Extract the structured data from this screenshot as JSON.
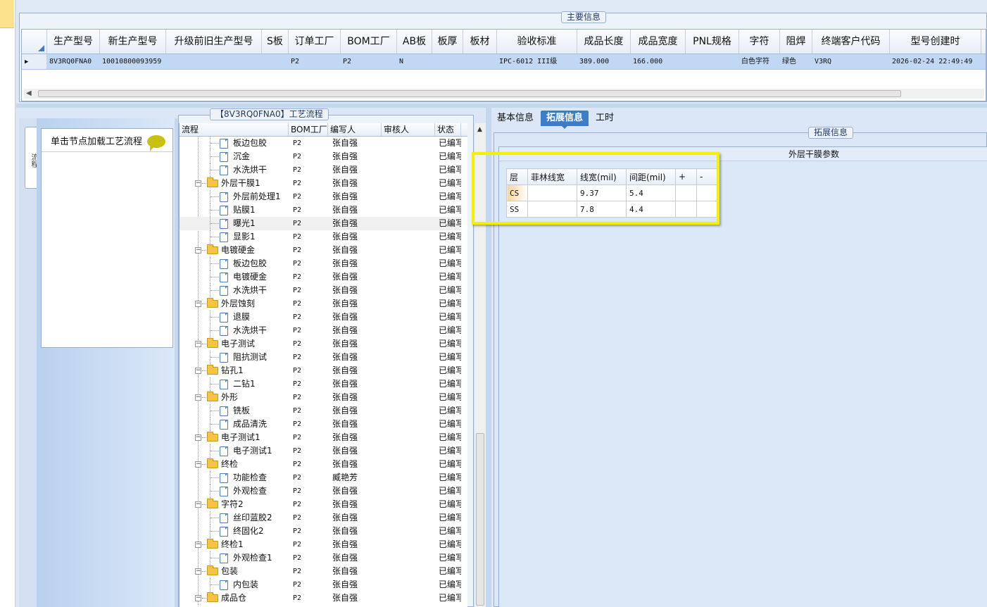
{
  "primary": {
    "title": "主要信息",
    "columns": [
      "生产型号",
      "新生产型号",
      "升级前旧生产型号",
      "S板",
      "订单工厂",
      "BOM工厂",
      "AB板",
      "板厚",
      "板材",
      "验收标准",
      "成品长度",
      "成品宽度",
      "PNL规格",
      "字符",
      "阻焊",
      "终端客户代码",
      "型号创建时"
    ],
    "row": [
      "8V3RQ0FNA0",
      "10010800093959",
      "",
      "",
      "P2",
      "P2",
      "N",
      "",
      "",
      "IPC-6012 III级",
      "389.000",
      "166.000",
      "",
      "白色字符",
      "绿色",
      "V3RQ",
      "2026-02-24 22:49:49"
    ],
    "row_marker": "▶"
  },
  "side_tab": "流程",
  "nav": {
    "hint": "单击节点加载工艺流程"
  },
  "process": {
    "title": "【8V3RQ0FNA0】工艺流程",
    "columns": [
      "流程",
      "BOM工厂",
      "编写人",
      "审核人",
      "状态"
    ],
    "rows": [
      {
        "name": "板边包胶",
        "level": 2,
        "bom": "P2",
        "writer": "张自强",
        "reviewer": "",
        "status": "已编写"
      },
      {
        "name": "沉金",
        "level": 2,
        "bom": "P2",
        "writer": "张自强",
        "reviewer": "",
        "status": "已编写"
      },
      {
        "name": "水洗烘干",
        "level": 2,
        "bom": "P2",
        "writer": "张自强",
        "reviewer": "",
        "status": "已编写"
      },
      {
        "name": "外层干膜1",
        "level": 1,
        "bom": "P2",
        "writer": "张自强",
        "reviewer": "",
        "status": "已编写"
      },
      {
        "name": "外层前处理1",
        "level": 2,
        "bom": "P2",
        "writer": "张自强",
        "reviewer": "",
        "status": "已编写"
      },
      {
        "name": "贴膜1",
        "level": 2,
        "bom": "P2",
        "writer": "张自强",
        "reviewer": "",
        "status": "已编写"
      },
      {
        "name": "曝光1",
        "level": 2,
        "bom": "P2",
        "writer": "张自强",
        "reviewer": "",
        "status": "已编写",
        "selected": true
      },
      {
        "name": "显影1",
        "level": 2,
        "bom": "P2",
        "writer": "张自强",
        "reviewer": "",
        "status": "已编写"
      },
      {
        "name": "电镀硬金",
        "level": 1,
        "bom": "P2",
        "writer": "张自强",
        "reviewer": "",
        "status": "已编写"
      },
      {
        "name": "板边包胶",
        "level": 2,
        "bom": "P2",
        "writer": "张自强",
        "reviewer": "",
        "status": "已编写"
      },
      {
        "name": "电镀硬金",
        "level": 2,
        "bom": "P2",
        "writer": "张自强",
        "reviewer": "",
        "status": "已编写"
      },
      {
        "name": "水洗烘干",
        "level": 2,
        "bom": "P2",
        "writer": "张自强",
        "reviewer": "",
        "status": "已编写"
      },
      {
        "name": "外层蚀刻",
        "level": 1,
        "bom": "P2",
        "writer": "张自强",
        "reviewer": "",
        "status": "已编写"
      },
      {
        "name": "退膜",
        "level": 2,
        "bom": "P2",
        "writer": "张自强",
        "reviewer": "",
        "status": "已编写"
      },
      {
        "name": "水洗烘干",
        "level": 2,
        "bom": "P2",
        "writer": "张自强",
        "reviewer": "",
        "status": "已编写"
      },
      {
        "name": "电子测试",
        "level": 1,
        "bom": "P2",
        "writer": "张自强",
        "reviewer": "",
        "status": "已编写"
      },
      {
        "name": "阻抗测试",
        "level": 2,
        "bom": "P2",
        "writer": "张自强",
        "reviewer": "",
        "status": "已编写"
      },
      {
        "name": "钻孔1",
        "level": 1,
        "bom": "P2",
        "writer": "张自强",
        "reviewer": "",
        "status": "已编写"
      },
      {
        "name": "二钻1",
        "level": 2,
        "bom": "P2",
        "writer": "张自强",
        "reviewer": "",
        "status": "已编写"
      },
      {
        "name": "外形",
        "level": 1,
        "bom": "P2",
        "writer": "张自强",
        "reviewer": "",
        "status": "已编写"
      },
      {
        "name": "铣板",
        "level": 2,
        "bom": "P2",
        "writer": "张自强",
        "reviewer": "",
        "status": "已编写"
      },
      {
        "name": "成品清洗",
        "level": 2,
        "bom": "P2",
        "writer": "张自强",
        "reviewer": "",
        "status": "已编写"
      },
      {
        "name": "电子测试1",
        "level": 1,
        "bom": "P2",
        "writer": "张自强",
        "reviewer": "",
        "status": "已编写"
      },
      {
        "name": "电子测试1",
        "level": 2,
        "bom": "P2",
        "writer": "张自强",
        "reviewer": "",
        "status": "已编写"
      },
      {
        "name": "终检",
        "level": 1,
        "bom": "P2",
        "writer": "张自强",
        "reviewer": "",
        "status": "已编写"
      },
      {
        "name": "功能检查",
        "level": 2,
        "bom": "P2",
        "writer": "臧艳芳",
        "reviewer": "",
        "status": "已编写"
      },
      {
        "name": "外观检查",
        "level": 2,
        "bom": "P2",
        "writer": "张自强",
        "reviewer": "",
        "status": "已编写"
      },
      {
        "name": "字符2",
        "level": 1,
        "bom": "P2",
        "writer": "张自强",
        "reviewer": "",
        "status": "已编写"
      },
      {
        "name": "丝印蓝胶2",
        "level": 2,
        "bom": "P2",
        "writer": "张自强",
        "reviewer": "",
        "status": "已编写"
      },
      {
        "name": "终固化2",
        "level": 2,
        "bom": "P2",
        "writer": "张自强",
        "reviewer": "",
        "status": "已编写"
      },
      {
        "name": "终检1",
        "level": 1,
        "bom": "P2",
        "writer": "张自强",
        "reviewer": "",
        "status": "已编写"
      },
      {
        "name": "外观检查1",
        "level": 2,
        "bom": "P2",
        "writer": "张自强",
        "reviewer": "",
        "status": "已编写"
      },
      {
        "name": "包装",
        "level": 1,
        "bom": "P2",
        "writer": "张自强",
        "reviewer": "",
        "status": "已编写"
      },
      {
        "name": "内包装",
        "level": 2,
        "bom": "P2",
        "writer": "张自强",
        "reviewer": "",
        "status": "已编写"
      },
      {
        "name": "成品仓",
        "level": 1,
        "bom": "P2",
        "writer": "张自强",
        "reviewer": "",
        "status": "已编写"
      }
    ]
  },
  "tabs": [
    "基本信息",
    "拓展信息",
    "工时"
  ],
  "active_tab": 1,
  "ext": {
    "title": "拓展信息",
    "section": "外层干膜参数",
    "columns": [
      "层",
      "菲林线宽",
      "线宽(mil)",
      "间距(mil)",
      "+",
      "-"
    ],
    "rows": [
      [
        "CS",
        "",
        "9.37",
        "5.4",
        "",
        ""
      ],
      [
        "SS",
        "",
        "7.8",
        "4.4",
        "",
        ""
      ]
    ]
  },
  "colors": {
    "highlight": "#f4f100",
    "selected_row": "#c0d8f3",
    "active_tab": "#3d7cc9"
  }
}
